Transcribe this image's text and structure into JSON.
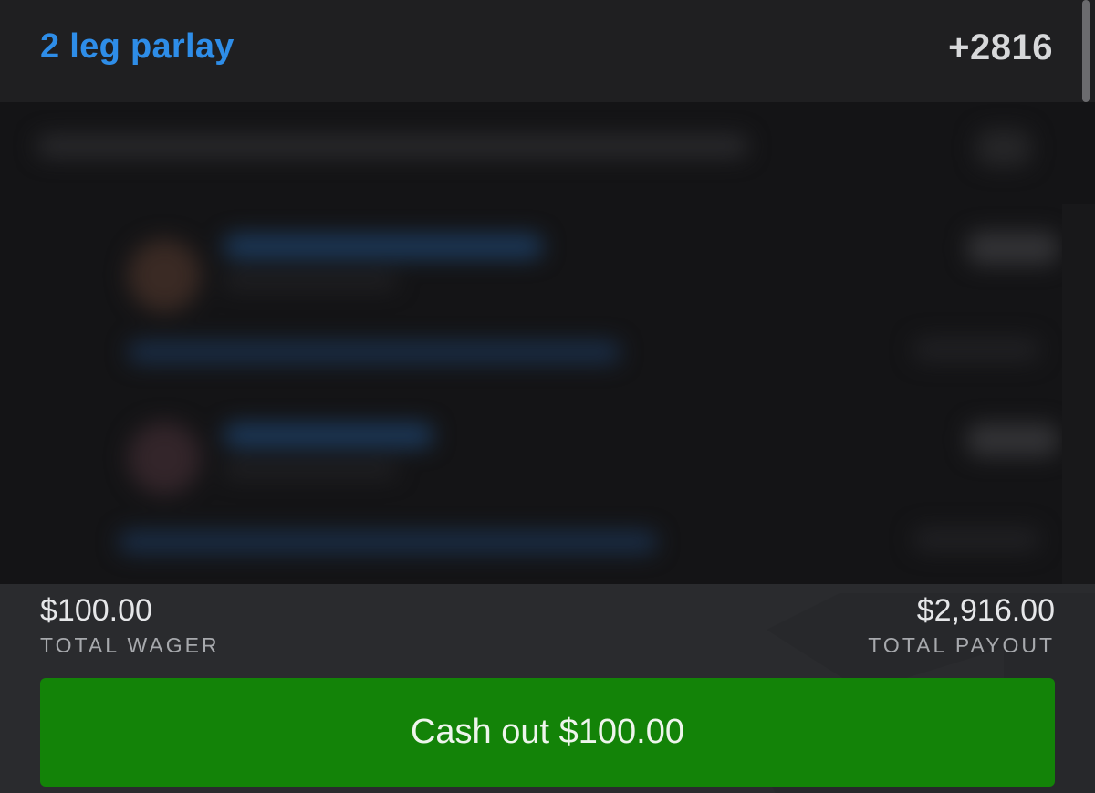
{
  "header": {
    "title": "2 leg parlay",
    "odds": "+2816"
  },
  "summary": {
    "wager_amount": "$100.00",
    "wager_label": "TOTAL WAGER",
    "payout_amount": "$2,916.00",
    "payout_label": "TOTAL PAYOUT"
  },
  "actions": {
    "cashout_label": "Cash out $100.00"
  },
  "colors": {
    "accent_blue": "#2e8de8",
    "cashout_green": "#138308",
    "background": "#1e1e20",
    "footer_background": "#2a2b2e"
  }
}
